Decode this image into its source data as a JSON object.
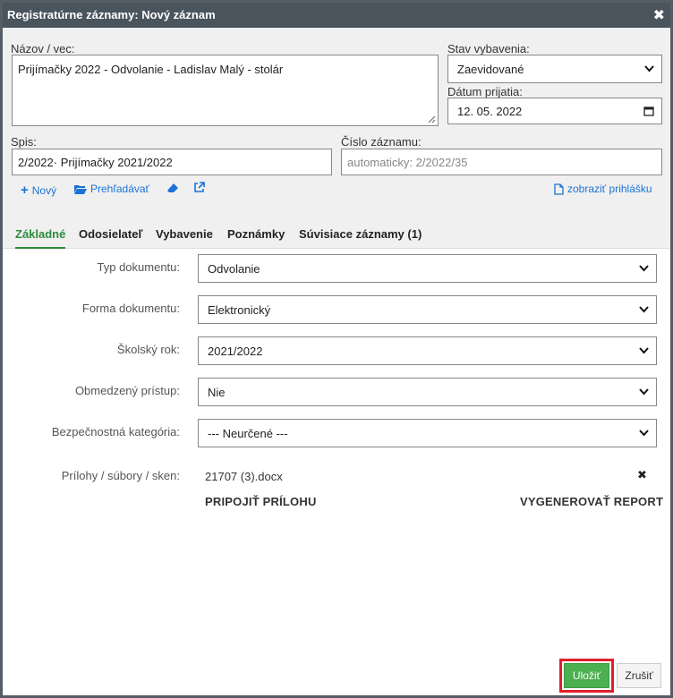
{
  "dialog": {
    "title": "Registratúrne záznamy: Nový záznam",
    "close_glyph": "✖"
  },
  "header_form": {
    "nazov_label": "Názov / vec:",
    "nazov_value": "Prijímačky 2022 - Odvolanie - Ladislav Malý - stolár",
    "stav_label": "Stav vybavenia:",
    "stav_value": "Zaevidované",
    "datum_label": "Dátum prijatia:",
    "datum_value": "12. 05. 2022",
    "spis_label": "Spis:",
    "spis_value": "2/2022· Prijímačky 2021/2022",
    "cislo_label": "Číslo záznamu:",
    "cislo_placeholder": "automaticky: 2/2022/35"
  },
  "actions": {
    "novy": "Nový",
    "prehladavat": "Prehľadávať",
    "zobrazit_prihlasku": "zobraziť prihlášku"
  },
  "tabs": [
    "Základné",
    "Odosielateľ",
    "Vybavenie",
    "Poznámky",
    "Súvisiace záznamy (1)"
  ],
  "active_tab": "Základné",
  "fields": {
    "typ_label": "Typ dokumentu:",
    "typ_value": "Odvolanie",
    "forma_label": "Forma dokumentu:",
    "forma_value": "Elektronický",
    "rok_label": "Školský rok:",
    "rok_value": "2021/2022",
    "pristup_label": "Obmedzený prístup:",
    "pristup_value": "Nie",
    "bezp_label": "Bezpečnostná kategória:",
    "bezp_value": "--- Neurčené ---",
    "prilohy_label": "Prílohy / súbory / sken:"
  },
  "attachment": {
    "filename": "21707 (3).docx",
    "pripojit": "PRIPOJIŤ PRÍLOHU",
    "vygenerovat": "VYGENEROVAŤ REPORT"
  },
  "footer": {
    "save": "Uložiť",
    "cancel": "Zrušiť"
  },
  "colors": {
    "titlebar": "#4a545d",
    "accent_link": "#1a73d6",
    "active_tab": "#2e8b3c",
    "save_button": "#4caf50",
    "highlight": "#e0202a"
  }
}
